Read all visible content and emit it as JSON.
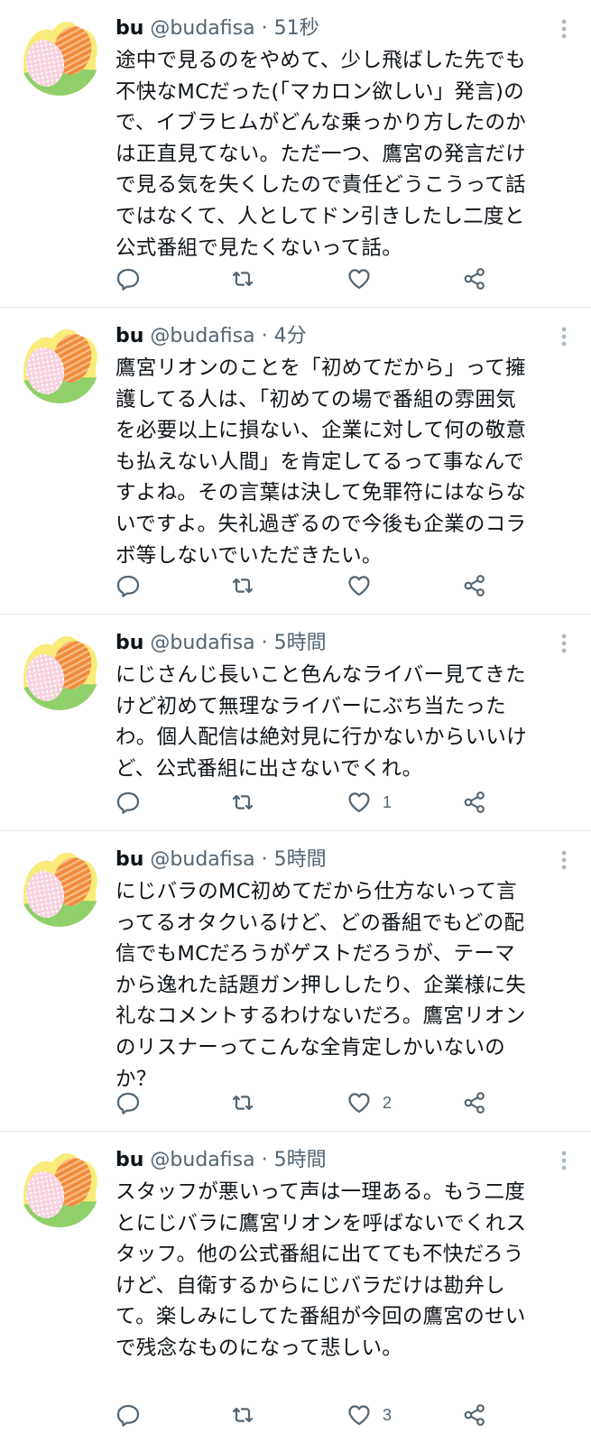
{
  "user": {
    "name": "bu",
    "handle": "@budafisa",
    "separator": "·"
  },
  "colors": {
    "text": "#0f1419",
    "secondary": "#536471",
    "divider": "#e6ecf0",
    "avatar_yellow": "#f9ec7a",
    "avatar_green": "#8fd06a",
    "avatar_pink": "#f3c6d6",
    "avatar_orange": "#f08a3e"
  },
  "tweets": [
    {
      "time": "51秒",
      "lines": [
        "途中で見るのをやめて、少し飛ばした先でも",
        "不快なMCだった(「マカロン欲しい」発言)の",
        "で、イブラヒムがどんな乗っかり方したのか",
        "は正直見てない。ただ一つ、鷹宮の発言だけ",
        "で見る気を失くしたので責任どうこうって話",
        "ではなくて、人としてドン引きしたし二度と",
        "公式番組で見たくないって話。"
      ],
      "likes": ""
    },
    {
      "time": "4分",
      "lines": [
        "鷹宮リオンのことを「初めてだから」って擁",
        "護してる人は、「初めての場で番組の雰囲気",
        "を必要以上に損ない、企業に対して何の敬意",
        "も払えない人間」を肯定してるって事なんで",
        "すよね。その言葉は決して免罪符にはならな",
        "いですよ。失礼過ぎるので今後も企業のコラ",
        "ボ等しないでいただきたい。"
      ],
      "likes": ""
    },
    {
      "time": "5時間",
      "lines": [
        "にじさんじ長いこと色んなライバー見てきた",
        "けど初めて無理なライバーにぶち当たった",
        "わ。個人配信は絶対見に行かないからいいけ",
        "ど、公式番組に出さないでくれ。"
      ],
      "likes": "1"
    },
    {
      "time": "5時間",
      "lines": [
        "にじバラのMC初めてだから仕方ないって言",
        "ってるオタクいるけど、どの番組でもどの配",
        "信でもMCだろうがゲストだろうが、テーマ",
        "から逸れた話題ガン押ししたり、企業様に失",
        "礼なコメントするわけないだろ。鷹宮リオン",
        "のリスナーってこんな全肯定しかいないの",
        "か？"
      ],
      "likes": "2"
    },
    {
      "time": "5時間",
      "lines": [
        "スタッフが悪いって声は一理ある。もう二度",
        "とにじバラに鷹宮リオンを呼ばないでくれス",
        "タッフ。他の公式番組に出てても不快だろう",
        "けど、自衛するからにじバラだけは勘弁し",
        "て。楽しみにしてた番組が今回の鷹宮のせい",
        "で残念なものになって悲しい。"
      ],
      "likes": "3"
    }
  ]
}
